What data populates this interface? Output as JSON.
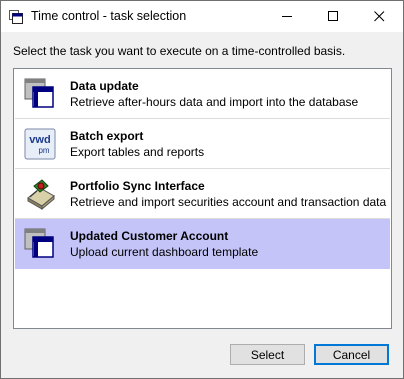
{
  "window": {
    "title": "Time control - task selection"
  },
  "titlebar": {
    "minimize_icon": "minimize-icon",
    "maximize_icon": "maximize-icon",
    "close_icon": "close-icon"
  },
  "instruction": "Select the task you want to execute on a time-controlled basis.",
  "tasks": [
    {
      "title": "Data update",
      "description": "Retrieve after-hours data and import into the database",
      "icon": "window-icon"
    },
    {
      "title": "Batch export",
      "description": "Export tables and reports",
      "icon": "vwd-pm-icon",
      "icon_text": [
        "vwd",
        "pm"
      ]
    },
    {
      "title": "Portfolio Sync Interface",
      "description": "Retrieve and import securities account and transaction data",
      "icon": "sync-interface-icon"
    },
    {
      "title": "Updated Customer Account",
      "description": "Upload current dashboard template",
      "icon": "window-icon",
      "selected": true
    }
  ],
  "buttons": {
    "select": "Select",
    "cancel": "Cancel"
  },
  "colors": {
    "selection": "#c4c4f8",
    "accent_border": "#0078d7",
    "icon_navy": "#000080"
  }
}
